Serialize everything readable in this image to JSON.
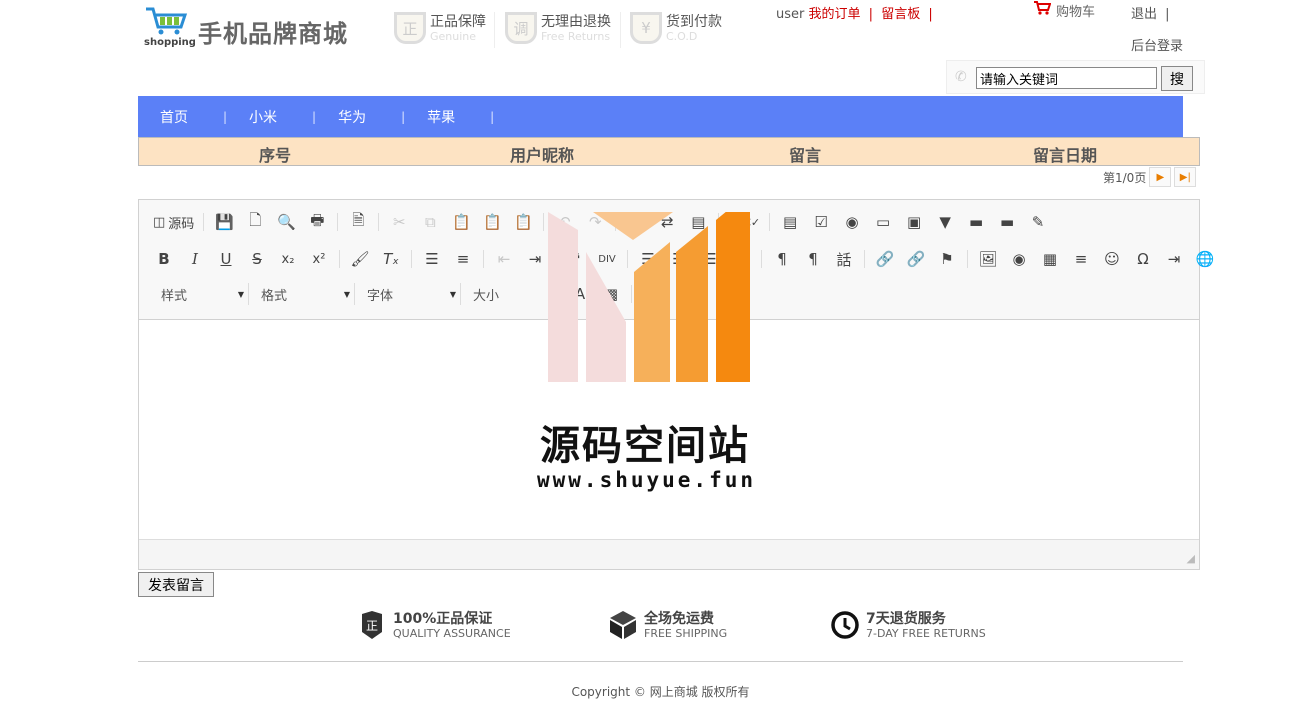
{
  "header": {
    "logo_caption": "shopping",
    "site_title": "手机品牌商城",
    "promos": [
      {
        "icon_char": "正",
        "title": "正品保障",
        "subtitle": "Genuine"
      },
      {
        "icon_char": "调",
        "title": "无理由退换",
        "subtitle": "Free Returns"
      },
      {
        "icon_char": "¥",
        "title": "货到付款",
        "subtitle": "C.O.D"
      }
    ],
    "user": "user",
    "my_orders": "我的订单",
    "sep": "|",
    "guestbook": "留言板",
    "cart": "购物车",
    "logout": "退出",
    "admin_login": "后台登录",
    "search_value": "请输入关键词",
    "search_button": "搜"
  },
  "nav": {
    "items": [
      "首页",
      "小米",
      "华为",
      "苹果"
    ],
    "sep": "|"
  },
  "table": {
    "headers": [
      "序号",
      "用户昵称",
      "留言",
      "留言日期"
    ]
  },
  "pager": {
    "text": "第1/0页"
  },
  "editor": {
    "source_label": "源码",
    "combos": [
      "样式",
      "格式",
      "字体",
      "大小"
    ]
  },
  "submit_label": "发表留言",
  "features": [
    {
      "title": "100%正品保证",
      "subtitle": "QUALITY ASSURANCE",
      "icon": "shield-icon"
    },
    {
      "title": "全场免运费",
      "subtitle": "FREE SHIPPING",
      "icon": "box-icon"
    },
    {
      "title": "7天退货服务",
      "subtitle": "7-DAY FREE RETURNS",
      "icon": "clock-icon"
    }
  ],
  "footer": {
    "copyright": "Copyright © 网上商城 版权所有"
  },
  "watermark": {
    "title": "源码空间站",
    "url": "www.shuyue.fun"
  },
  "colors": {
    "nav_bg": "#5b80f7",
    "table_header_bg": "#fde3c3",
    "accent_red": "#cc0000",
    "watermark_orange": "#f5890f"
  }
}
